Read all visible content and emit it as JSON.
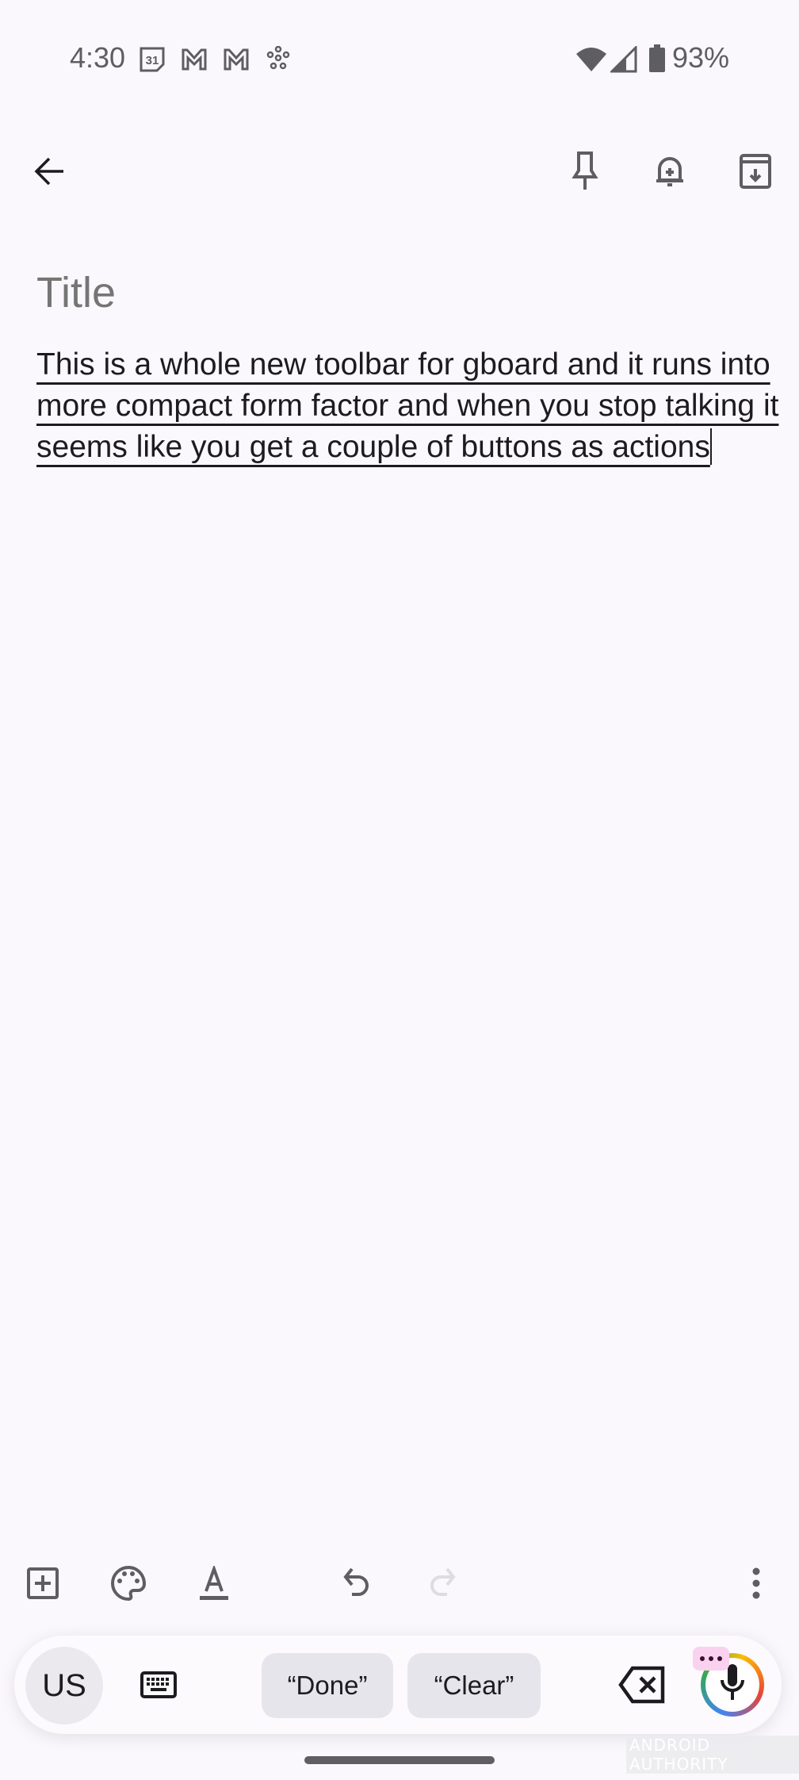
{
  "status_bar": {
    "time": "4:30",
    "notification_icons": [
      "calendar-icon",
      "gmail-icon",
      "gmail-icon",
      "fan-icon"
    ],
    "calendar_day": "31",
    "system_icons": [
      "wifi-icon",
      "signal-icon",
      "battery-icon"
    ],
    "battery_percent": "93%"
  },
  "app_bar": {
    "back_icon": "arrow-back-icon",
    "actions": [
      "pin-icon",
      "reminder-bell-icon",
      "archive-icon"
    ]
  },
  "note": {
    "title_placeholder": "Title",
    "title_value": "",
    "body_text": "This is a whole new toolbar for gboard and it runs into more compact form factor and when you stop talking it seems like you get a couple of buttons as actions"
  },
  "bottom_toolbar": {
    "left_actions": [
      "add-box-icon",
      "palette-icon",
      "text-format-icon"
    ],
    "undo_icon": "undo-icon",
    "redo_icon": "redo-icon",
    "redo_enabled": false,
    "more_icon": "more-vert-icon"
  },
  "keyboard_bar": {
    "language_label": "US",
    "keyboard_icon": "keyboard-icon",
    "suggestions": [
      "“Done”",
      "“Clear”"
    ],
    "delete_icon": "backspace-icon",
    "mic_icon": "mic-icon",
    "badge_icon": "more-horiz-icon",
    "badge_color": "#fbd1f0"
  },
  "watermark": "ANDROID AUTHORITY",
  "colors": {
    "background": "#fbf8fd",
    "icon_gray": "#5e5d62",
    "chip_bg": "#e7e5ec",
    "text": "#1c1b1f"
  }
}
